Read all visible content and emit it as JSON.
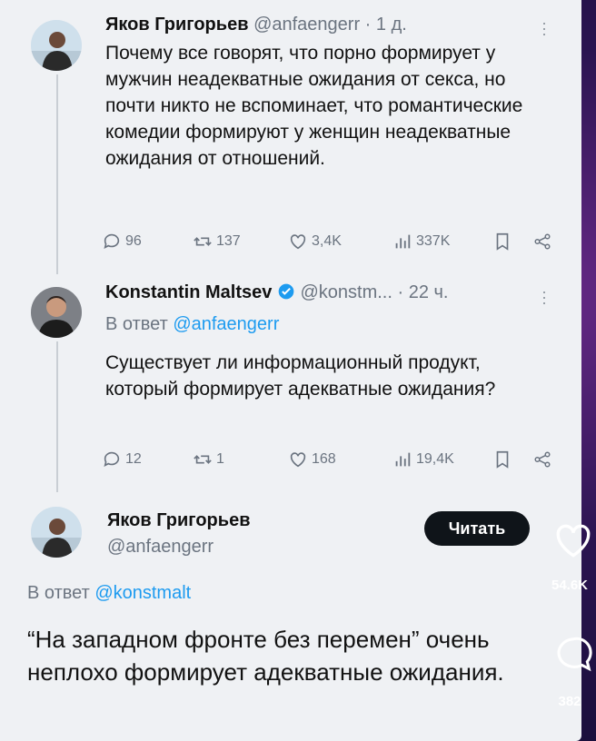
{
  "tweet1": {
    "name": "Яков Григорьев",
    "handle": "@anfaengerr",
    "time": "· 1 д.",
    "text": "Почему все говорят, что порно формирует у мужчин неадекватные ожидания от секса, но почти никто не вспоминает, что романтические комедии формируют у женщин неадекватные ожидания от отношений.",
    "replies": "96",
    "retweets": "137",
    "likes": "3,4K",
    "views": "337K"
  },
  "tweet2": {
    "name": "Konstantin Maltsev",
    "handle": "@konstm...",
    "time": "· 22 ч.",
    "reply_prefix": "В ответ",
    "reply_handle": "@anfaengerr",
    "text": "Существует ли информационный продукт, который формирует адекватные ожидания?",
    "replies": "12",
    "retweets": "1",
    "likes": "168",
    "views": "19,4K"
  },
  "tweet3": {
    "name": "Яков Григорьев",
    "handle": "@anfaengerr",
    "follow_label": "Читать",
    "reply_prefix": "В ответ",
    "reply_handle": "@konstmalt",
    "text": "“На западном фронте без перемен” очень неплохо формирует адекватные ожидания."
  },
  "side": {
    "likes": "54.6K",
    "comments": "382"
  },
  "colors": {
    "accent": "#1d9bf0",
    "verified": "#1d9bf0",
    "text": "#111111",
    "muted": "#6b7480"
  }
}
